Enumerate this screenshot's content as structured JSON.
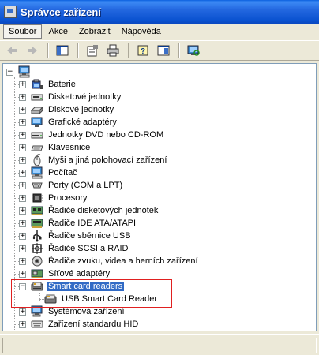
{
  "window": {
    "title": "Správce zařízení"
  },
  "menu": [
    {
      "label": "Soubor"
    },
    {
      "label": "Akce"
    },
    {
      "label": "Zobrazit"
    },
    {
      "label": "Nápověda"
    }
  ],
  "toolbar": {
    "buttons": [
      "back-arrow-icon",
      "forward-arrow-icon",
      "console-tree-icon",
      "properties-icon",
      "print-icon",
      "help-icon",
      "show-hide-icon",
      "scan-hardware-icon"
    ]
  },
  "tree": {
    "root_icon": "computer-icon",
    "categories": [
      {
        "label": "Baterie",
        "icon": "battery-icon",
        "expanded": false
      },
      {
        "label": "Disketové jednotky",
        "icon": "floppy-drive-icon",
        "expanded": false
      },
      {
        "label": "Diskové jednotky",
        "icon": "disk-drive-icon",
        "expanded": false
      },
      {
        "label": "Grafické adaptéry",
        "icon": "display-adapter-icon",
        "expanded": false
      },
      {
        "label": "Jednotky DVD nebo CD-ROM",
        "icon": "cdrom-icon",
        "expanded": false
      },
      {
        "label": "Klávesnice",
        "icon": "keyboard-icon",
        "expanded": false
      },
      {
        "label": "Myši a jiná polohovací zařízení",
        "icon": "mouse-icon",
        "expanded": false
      },
      {
        "label": "Počítač",
        "icon": "computer-icon",
        "expanded": false
      },
      {
        "label": "Porty (COM a LPT)",
        "icon": "port-icon",
        "expanded": false
      },
      {
        "label": "Procesory",
        "icon": "processor-icon",
        "expanded": false
      },
      {
        "label": "Řadiče disketových jednotek",
        "icon": "floppy-controller-icon",
        "expanded": false
      },
      {
        "label": "Řadiče IDE ATA/ATAPI",
        "icon": "ide-controller-icon",
        "expanded": false
      },
      {
        "label": "Řadiče sběrnice USB",
        "icon": "usb-icon",
        "expanded": false
      },
      {
        "label": "Řadiče SCSI a RAID",
        "icon": "scsi-icon",
        "expanded": false
      },
      {
        "label": "Řadiče zvuku, videa a herních zařízení",
        "icon": "sound-icon",
        "expanded": false
      },
      {
        "label": "Síťové adaptéry",
        "icon": "network-adapter-icon",
        "expanded": false
      },
      {
        "label": "Smart card readers",
        "icon": "smart-card-reader-icon",
        "expanded": true,
        "selected": true,
        "children": [
          {
            "label": "USB Smart Card Reader",
            "icon": "smart-card-reader-icon"
          }
        ]
      },
      {
        "label": "Systémová zařízení",
        "icon": "system-device-icon",
        "expanded": false
      },
      {
        "label": "Zařízení standardu HID",
        "icon": "hid-icon",
        "expanded": false
      }
    ]
  },
  "colors": {
    "titlebar": "#0a52d0",
    "selection": "#316ac5",
    "highlight_box": "#e02020"
  }
}
